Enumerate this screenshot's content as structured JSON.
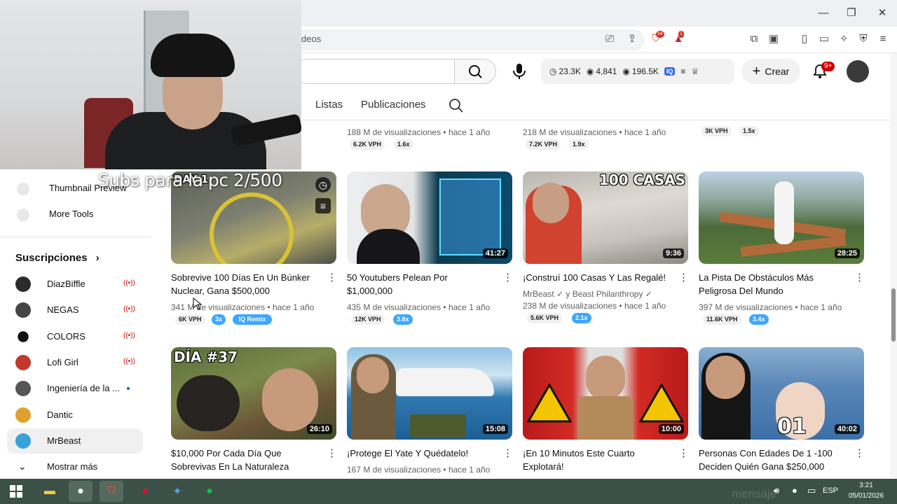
{
  "browser": {
    "address_partial": "deos",
    "badge_brave": "54",
    "badge_alert": "1"
  },
  "header": {
    "stats": {
      "views_1": "23.3K",
      "views_2": "4,841",
      "views_3": "196.5K"
    },
    "create_label": "Crear",
    "notifications_badge": "9+"
  },
  "channel_tabs": [
    "Listas",
    "Publicaciones"
  ],
  "overlay_text": "Subs para la pc 2/500",
  "sidebar": {
    "tools": [
      {
        "label": "Thumbnail Preview",
        "icon": "iq-icon"
      },
      {
        "label": "More Tools",
        "icon": "iq-icon"
      }
    ],
    "subscriptions_heading": "Suscripciones",
    "subscriptions": [
      {
        "name": "DiazBiffle",
        "indicator": "live",
        "avatar_color": "#2b2b2b"
      },
      {
        "name": "NEGAS",
        "indicator": "live",
        "avatar_color": "#444444"
      },
      {
        "name": "COLORS",
        "indicator": "live",
        "avatar_color": "#111111"
      },
      {
        "name": "Lofi Girl",
        "indicator": "live",
        "avatar_color": "#c0392b"
      },
      {
        "name": "Ingeniería de la ...",
        "indicator": "dot",
        "avatar_color": "#555555"
      },
      {
        "name": "Dantic",
        "indicator": "",
        "avatar_color": "#e0a030"
      },
      {
        "name": "MrBeast",
        "indicator": "",
        "avatar_color": "#3aa0d8"
      }
    ],
    "show_more": "Mostrar más",
    "live_glyph": "((•))"
  },
  "top_row_partial": [
    {
      "meta": "188 M de visualizaciones • hace 1 año",
      "vph": "6.2K VPH",
      "ratio": "1.6x"
    },
    {
      "meta": "218 M de visualizaciones • hace 1 año",
      "vph": "7.2K VPH",
      "ratio": "1.9x"
    },
    {
      "meta": "",
      "vph": "3K VPH",
      "ratio": "1.5x"
    }
  ],
  "videos_row1": [
    {
      "title": "Sobrevive 100 Días En Un Búnker Nuclear, Gana $500,000",
      "meta": "341 M de visualizaciones • hace 1 año",
      "vph": "6K VPH",
      "ratio": "3x",
      "extra_pill": "Remix",
      "thumb_text": "DAY 1",
      "duration": ""
    },
    {
      "title": "50 Youtubers Pelean Por $1,000,000",
      "meta": "435 M de visualizaciones • hace 1 año",
      "vph": "12K VPH",
      "ratio": "3.8x",
      "thumb_text": "",
      "duration": "41:27"
    },
    {
      "title": "¡Construí 100 Casas Y Las Regalé!",
      "channel_line": "MrBeast ✓ y Beast Philanthropy ✓",
      "meta": "238 M de visualizaciones • hace 1 año",
      "vph": "5.6K VPH",
      "ratio": "2.1x",
      "thumb_text": "100 CASAS",
      "duration": "9:36"
    },
    {
      "title": "La Pista De Obstáculos Más Peligrosa Del Mundo",
      "meta": "397 M de visualizaciones • hace 1 año",
      "vph": "11.6K VPH",
      "ratio": "3.4x",
      "thumb_text": "",
      "duration": "28:25"
    }
  ],
  "videos_row2": [
    {
      "title": "$10,000 Por Cada Día Que Sobrevivas En La Naturaleza",
      "meta": "",
      "thumb_text": "DÍA #37",
      "duration": "26:10"
    },
    {
      "title": "¡Protege El Yate Y Quédatelo!",
      "meta": "167 M de visualizaciones • hace 1 año",
      "thumb_text": "",
      "duration": "15:08"
    },
    {
      "title": "¡En 10 Minutos Este Cuarto Explotará!",
      "meta": "",
      "thumb_text": "",
      "duration": "10:00"
    },
    {
      "title": "Personas Con Edades De 1 -100 Deciden Quién Gana $250,000",
      "meta": "",
      "thumb_text": "01",
      "duration": "40:02"
    }
  ],
  "taskbar": {
    "language": "ESP",
    "time": "3:21",
    "date": "05/01/2026",
    "background_text": "mensaje"
  },
  "colors": {
    "live_red": "#cc0000",
    "pill_blue": "#3ea6ff",
    "taskbar": "#3b5147"
  }
}
